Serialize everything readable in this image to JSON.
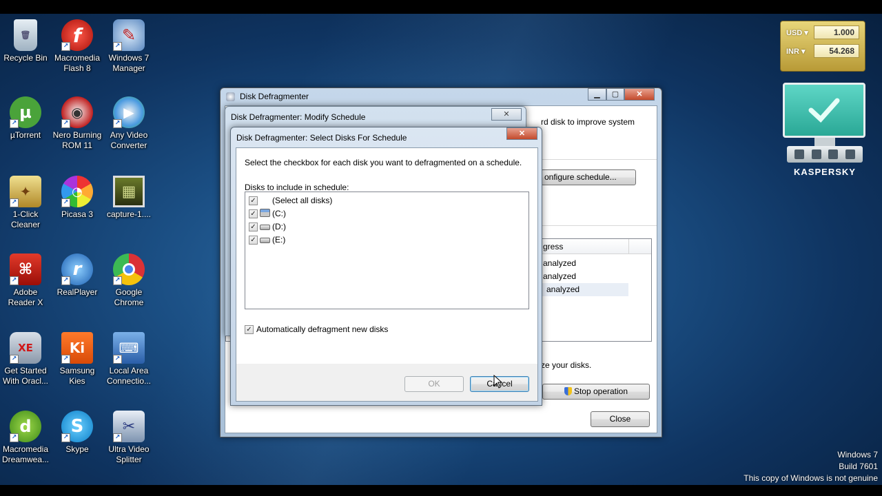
{
  "desktop_icons": [
    {
      "label": "Recycle Bin",
      "icon": "recycle-bin-icon",
      "glyph": "🗑"
    },
    {
      "label": "Macromedia Flash 8",
      "icon": "flash-icon",
      "glyph": "f"
    },
    {
      "label": "Windows 7 Manager",
      "icon": "win7-manager-icon",
      "glyph": "✎"
    },
    {
      "label": "µTorrent",
      "icon": "utorrent-icon",
      "glyph": "µ"
    },
    {
      "label": "Nero Burning ROM 11",
      "icon": "nero-icon",
      "glyph": "◉"
    },
    {
      "label": "Any Video Converter",
      "icon": "any-video-converter-icon",
      "glyph": "▶"
    },
    {
      "label": "1-Click Cleaner",
      "icon": "cleaner-icon",
      "glyph": "✦"
    },
    {
      "label": "Picasa 3",
      "icon": "picasa-icon",
      "glyph": "◔"
    },
    {
      "label": "capture-1....",
      "icon": "video-file-icon",
      "glyph": "▦"
    },
    {
      "label": "Adobe Reader X",
      "icon": "adobe-reader-icon",
      "glyph": "⌘"
    },
    {
      "label": "RealPlayer",
      "icon": "realplayer-icon",
      "glyph": "r"
    },
    {
      "label": "Google Chrome",
      "icon": "chrome-icon",
      "glyph": "◎"
    },
    {
      "label": "Get Started With Oracl...",
      "icon": "oracle-icon",
      "glyph": "XE"
    },
    {
      "label": "Samsung Kies",
      "icon": "samsung-kies-icon",
      "glyph": "Ki"
    },
    {
      "label": "Local Area Connectio...",
      "icon": "network-icon",
      "glyph": "⌨"
    },
    {
      "label": "Macromedia Dreamwea...",
      "icon": "dreamweaver-icon",
      "glyph": "d"
    },
    {
      "label": "Skype",
      "icon": "skype-icon",
      "glyph": "S"
    },
    {
      "label": "Ultra Video Splitter",
      "icon": "video-splitter-icon",
      "glyph": "✂"
    }
  ],
  "currency_gadget": {
    "rows": [
      {
        "currency": "USD ▾",
        "value": "1.000"
      },
      {
        "currency": "INR ▾",
        "value": "54.268"
      }
    ]
  },
  "kaspersky": {
    "brand": "KASPERSKY"
  },
  "watermark": {
    "line1": "Windows 7",
    "line2": "Build 7601",
    "line3": "This copy of Windows is not genuine"
  },
  "defragmenter": {
    "title": "Disk Defragmenter",
    "desc_fragment": "rd disk to improve system",
    "configure_button": "onfigure schedule...",
    "progress_header": "gress",
    "progress_rows": [
      "analyzed",
      "analyzed",
      "analyzed"
    ],
    "optimize_text": "ze your disks.",
    "stop_button": "Stop operation",
    "close_button": "Close"
  },
  "modify_schedule": {
    "title": "Disk Defragmenter: Modify Schedule"
  },
  "select_disks": {
    "title": "Disk Defragmenter: Select Disks For Schedule",
    "instruction": "Select the checkbox for each disk you want to defragmented on a schedule.",
    "list_label": "Disks to include in schedule:",
    "items": [
      {
        "label": "(Select all disks)",
        "checked": true
      },
      {
        "label": "(C:)",
        "checked": true
      },
      {
        "label": "(D:)",
        "checked": true
      },
      {
        "label": "(E:)",
        "checked": true
      }
    ],
    "auto_label": "Automatically defragment new disks",
    "ok_button": "OK",
    "cancel_button": "Cancel"
  }
}
